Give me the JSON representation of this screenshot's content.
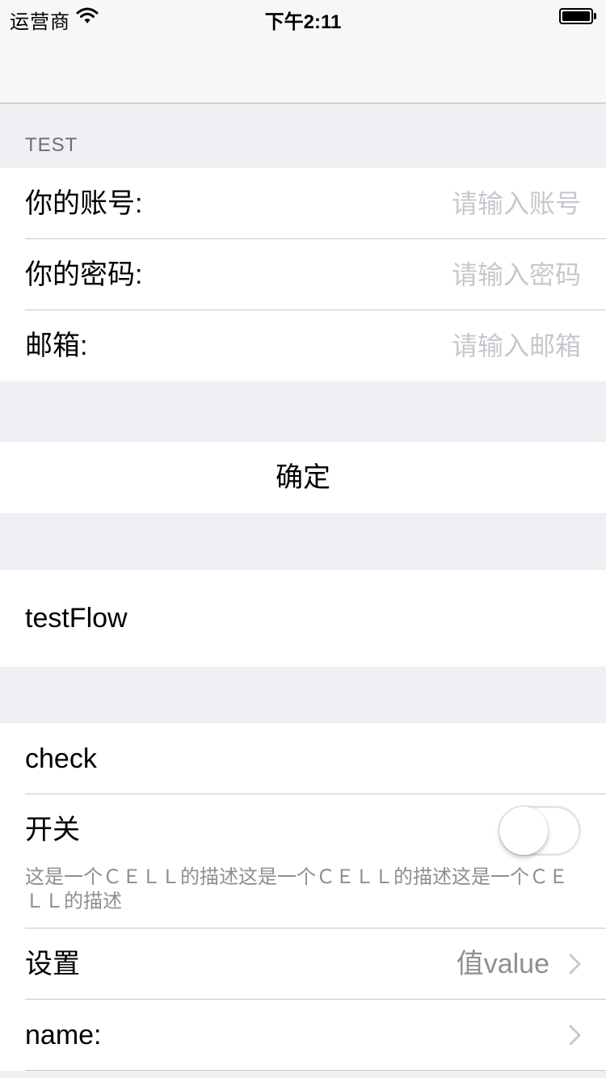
{
  "status_bar": {
    "carrier": "运营商",
    "time": "下午2:11"
  },
  "form_section": {
    "header": "TEST",
    "fields": [
      {
        "label": "你的账号:",
        "placeholder": "请输入账号",
        "value": ""
      },
      {
        "label": "你的密码:",
        "placeholder": "请输入密码",
        "value": ""
      },
      {
        "label": "邮箱:",
        "placeholder": "请输入邮箱",
        "value": ""
      }
    ]
  },
  "confirm_label": "确定",
  "flow_label": "testFlow",
  "settings": {
    "check_label": "check",
    "switch_label": "开关",
    "switch_on": false,
    "switch_description": "这是一个ＣＥＬＬ的描述这是一个ＣＥＬＬ的描述这是一个ＣＥＬＬ的描述",
    "setting_label": "设置",
    "setting_value": "值value",
    "name_label": "name:"
  },
  "colors": {
    "background": "#efeff4",
    "placeholder": "#c7c7cd",
    "secondary_text": "#8e8e93",
    "separator": "#c8c7cc"
  }
}
